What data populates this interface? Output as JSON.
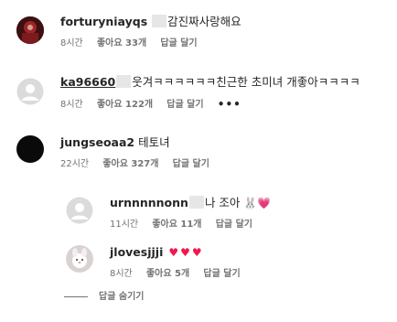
{
  "comments": [
    {
      "username": "fortury​niayqs",
      "text": "감진짜사랑해요",
      "time": "8시간",
      "likes": "좋아요 33개",
      "reply_label": "답글 달기"
    },
    {
      "username": "ka96660",
      "text": "웃겨ㅋㅋㅋㅋㅋㅋ친근한 초미녀 개좋아ㅋㅋㅋㅋ",
      "time": "8시간",
      "likes": "좋아요 122개",
      "reply_label": "답글 달기",
      "more": "•••"
    },
    {
      "username": "jungseoaa2",
      "text": "테토녀",
      "time": "22시간",
      "likes": "좋아요 327개",
      "reply_label": "답글 달기"
    }
  ],
  "replies": [
    {
      "username": "urnnnnnonn",
      "text": "나 조아",
      "emoji": [
        "🐰",
        "💗"
      ],
      "time": "11시간",
      "likes": "좋아요 11개",
      "reply_label": "답글 달기"
    },
    {
      "username": "jlovesjjji",
      "emoji": [
        "♥",
        "♥",
        "♥"
      ],
      "time": "8시간",
      "likes": "좋아요 5개",
      "reply_label": "답글 달기"
    }
  ],
  "hide_replies_label": "답글 숨기기",
  "colors": {
    "text": "#262626",
    "meta": "#737373",
    "heart": "#ed1a4b"
  }
}
